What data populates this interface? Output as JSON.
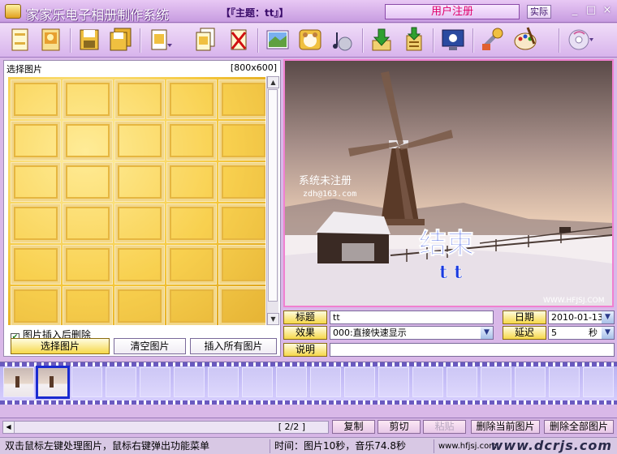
{
  "app": {
    "title": "家家乐电子相册制作系统",
    "theme": "【『主题：tt』】",
    "register_label": "用户注册",
    "small_button_label": "实际",
    "win_min": "_",
    "win_max": "□",
    "win_close": "×"
  },
  "toolbar": {
    "buttons": [
      {
        "name": "new-album-button",
        "icon": "blank-page-icon"
      },
      {
        "name": "open-album-button",
        "icon": "photo-page-icon"
      },
      {
        "name": "save-button",
        "icon": "floppy-icon"
      },
      {
        "name": "save-as-button",
        "icon": "floppy-stack-icon"
      },
      {
        "name": "insert-page-button",
        "icon": "document-icon"
      },
      {
        "name": "copy-page-button",
        "icon": "document-copy-icon"
      },
      {
        "name": "delete-page-button",
        "icon": "document-delete-icon"
      },
      {
        "name": "background-button",
        "icon": "picture-icon"
      },
      {
        "name": "frame-button",
        "icon": "bear-frame-icon"
      },
      {
        "name": "music-button",
        "icon": "music-note-icon"
      },
      {
        "name": "download-button",
        "icon": "green-down-arrow-icon"
      },
      {
        "name": "export-button",
        "icon": "green-arrow-export-icon"
      },
      {
        "name": "screen-button",
        "icon": "monitor-icon"
      },
      {
        "name": "tools-button",
        "icon": "wrench-tools-icon"
      },
      {
        "name": "paint-button",
        "icon": "paint-palette-icon"
      },
      {
        "name": "disc-button",
        "icon": "disc-icon"
      }
    ]
  },
  "left_panel": {
    "title": "选择图片",
    "size": "[800x600]",
    "checkbox_label": "图片插入后删除",
    "checkbox_checked": true,
    "select_button": "选择图片",
    "clear_button": "清空图片",
    "insert_all_button": "插入所有图片"
  },
  "preview": {
    "watermark_title": "系统未注册",
    "watermark_email": "zdh@163.com",
    "end_text": "结束",
    "subtitle": "tt",
    "site": "WWW.HFJSJ.COM"
  },
  "info": {
    "title_label": "标题",
    "title_value": "tt",
    "date_label": "日期",
    "date_value": "2010-01-13",
    "effect_label": "效果",
    "effect_value": "000:直接快速显示",
    "delay_label": "延迟",
    "delay_value": "5",
    "delay_unit": "秒",
    "desc_label": "说明",
    "desc_value": ""
  },
  "bottom": {
    "page_indicator": "[ 2/2 ]",
    "copy": "复制",
    "cut": "剪切",
    "paste": "粘贴",
    "delete_current": "删除当前图片",
    "delete_all": "删除全部图片"
  },
  "status": {
    "hint": "双击鼠标左键处理图片，鼠标右键弹出功能菜单",
    "time": "时间：图片10秒，音乐74.8秒",
    "site": "www.hfjsj.com",
    "watermark": "www.dcrjs.com"
  }
}
